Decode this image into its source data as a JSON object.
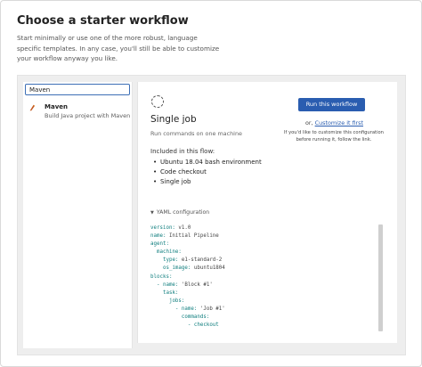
{
  "heading": "Choose a starter workflow",
  "intro": "Start minimally or use one of the more robust, language specific templates. In any case, you'll still be able to customize your workflow anyway you like.",
  "search": {
    "value": "Maven"
  },
  "workflows": [
    {
      "title": "Maven",
      "description": "Build Java project with Maven",
      "icon": "feather-icon"
    }
  ],
  "detail": {
    "title": "Single job",
    "subtitle": "Run commands on one machine",
    "run_button": "Run this workflow",
    "or_prefix": "or,",
    "customize_link": "Customize it first",
    "note": "If you'd like to customize this configuration before running it, follow the link.",
    "included_heading": "Included in this flow:",
    "included": [
      "Ubuntu 18.04 bash environment",
      "Code checkout",
      "Single job"
    ],
    "yaml_toggle": "YAML configuration"
  },
  "yaml_lines": [
    {
      "key": "version:",
      "value": " v1.0",
      "indent": 0
    },
    {
      "key": "name:",
      "value": " Initial Pipeline",
      "indent": 0
    },
    {
      "key": "agent:",
      "value": "",
      "indent": 0
    },
    {
      "key": "machine:",
      "value": "",
      "indent": 2
    },
    {
      "key": "type:",
      "value": " e1-standard-2",
      "indent": 4
    },
    {
      "key": "os_image:",
      "value": " ubuntu1804",
      "indent": 4
    },
    {
      "key": "blocks:",
      "value": "",
      "indent": 0
    },
    {
      "key": "- name:",
      "value": " 'Block #1'",
      "indent": 2
    },
    {
      "key": "task:",
      "value": "",
      "indent": 4
    },
    {
      "key": "jobs:",
      "value": "",
      "indent": 6
    },
    {
      "key": "- name:",
      "value": " 'Job #1'",
      "indent": 8
    },
    {
      "key": "commands:",
      "value": "",
      "indent": 10
    },
    {
      "key": "- checkout",
      "value": "",
      "indent": 12
    }
  ],
  "colors": {
    "accent": "#2a5db0",
    "yaml_key": "#0f7e7e"
  }
}
